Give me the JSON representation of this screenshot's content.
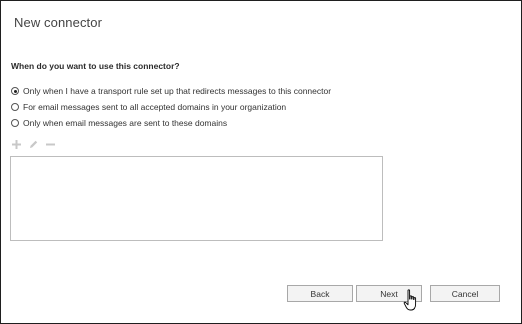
{
  "dialog": {
    "title": "New connector",
    "question": "When do you want to use this connector?",
    "options": [
      {
        "label": "Only when I have a transport rule set up that redirects messages to this connector",
        "selected": true
      },
      {
        "label": "For email messages sent to all accepted domains in your organization",
        "selected": false
      },
      {
        "label": "Only when email messages are sent to these domains",
        "selected": false
      }
    ],
    "toolbar": {
      "add_icon": "plus-icon",
      "edit_icon": "pencil-icon",
      "remove_icon": "minus-icon"
    },
    "domains": []
  },
  "buttons": {
    "back": "Back",
    "next": "Next",
    "cancel": "Cancel"
  },
  "colors": {
    "border": "#1f1f1f",
    "button_bg": "#f3f3f3",
    "disabled_icon": "#c8c8c8"
  }
}
